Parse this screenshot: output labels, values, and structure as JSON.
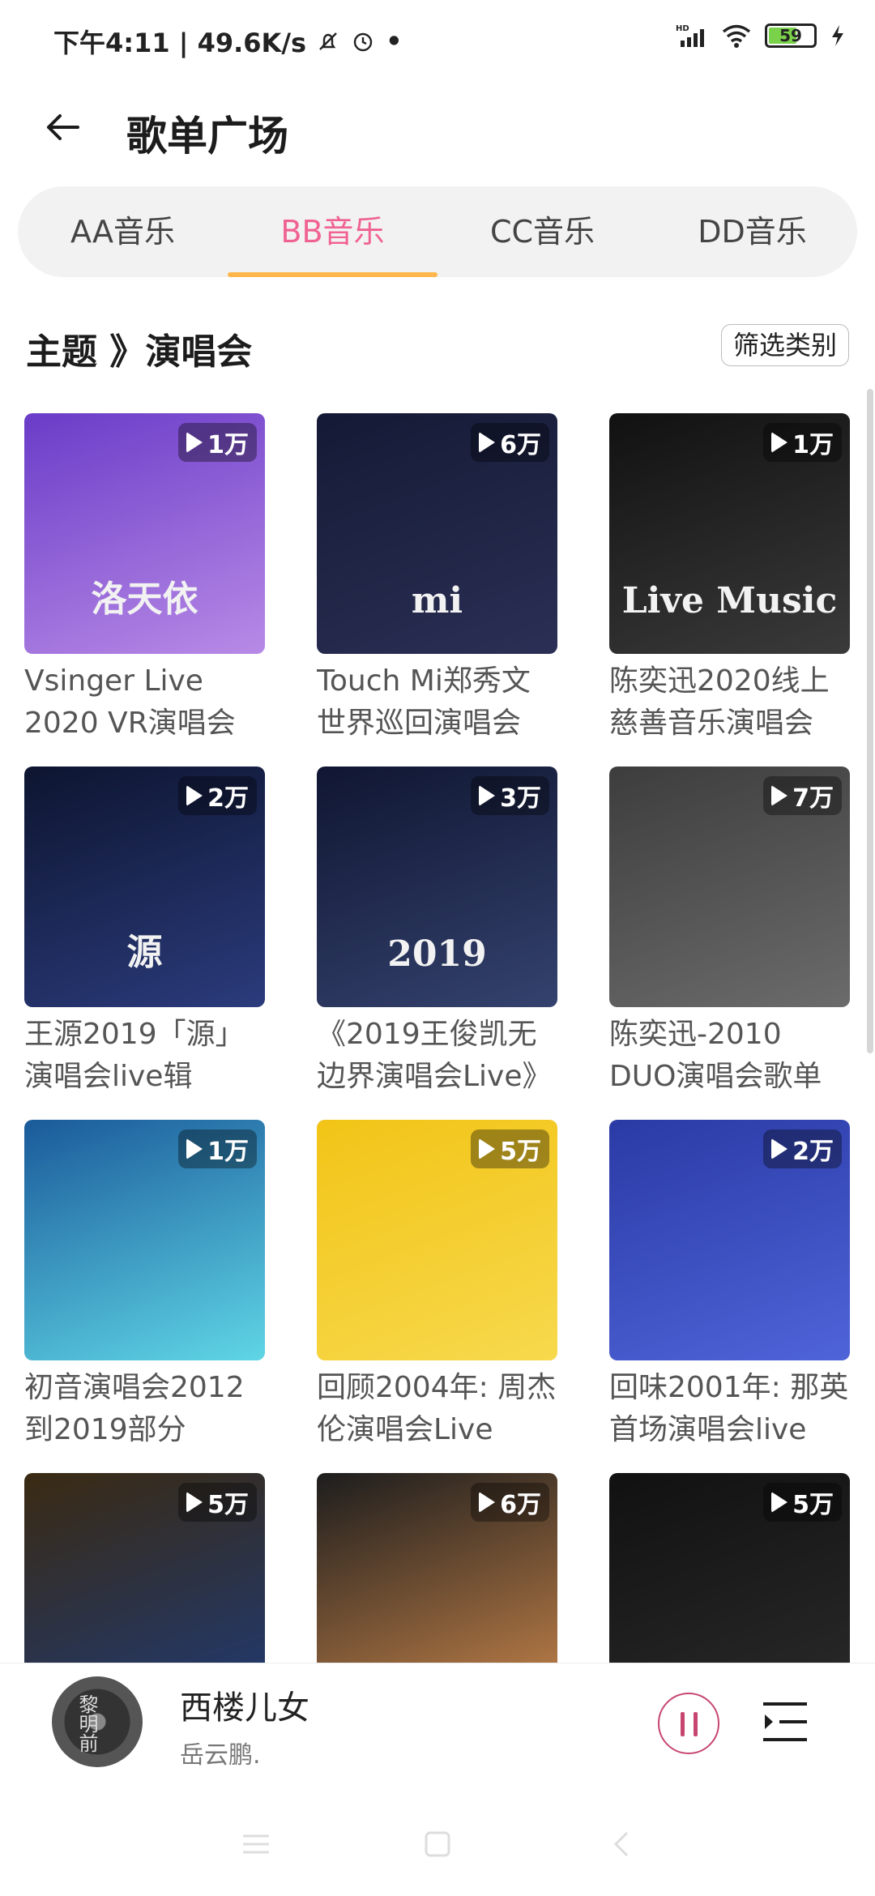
{
  "status_bar": {
    "time_speed": "下午4:11 | 49.6K/s",
    "battery": "59",
    "network": "HD"
  },
  "header": {
    "title": "歌单广场"
  },
  "tabs": [
    {
      "label": "AA音乐",
      "active": false
    },
    {
      "label": "BB音乐",
      "active": true
    },
    {
      "label": "CC音乐",
      "active": false
    },
    {
      "label": "DD音乐",
      "active": false
    }
  ],
  "section": {
    "crumb": "主题 》演唱会",
    "filter_label": "筛选类别"
  },
  "playlists": [
    {
      "name": "Vsinger Live 2020 VR演唱会",
      "plays": "1万",
      "cover_text": "洛天依",
      "cover_colors": [
        "#6a3cc8",
        "#b88ae6"
      ]
    },
    {
      "name": "Touch Mi郑秀文世界巡回演唱会",
      "plays": "6万",
      "cover_text": "mi",
      "cover_colors": [
        "#141a35",
        "#2b2f55"
      ]
    },
    {
      "name": "陈奕迅2020线上慈善音乐演唱会",
      "plays": "1万",
      "cover_text": "Live Music",
      "cover_colors": [
        "#111111",
        "#3a3a3a"
      ]
    },
    {
      "name": "王源2019「源」演唱会live辑",
      "plays": "2万",
      "cover_text": "源",
      "cover_colors": [
        "#0d1530",
        "#2b3b7c"
      ]
    },
    {
      "name": "《2019王俊凯无边界演唱会Live》",
      "plays": "3万",
      "cover_text": "2019",
      "cover_colors": [
        "#101632",
        "#34426e"
      ]
    },
    {
      "name": "陈奕迅-2010 DUO演唱会歌单",
      "plays": "7万",
      "cover_text": "",
      "cover_colors": [
        "#3d3d3d",
        "#6b6b6b"
      ]
    },
    {
      "name": "初音演唱会2012到2019部分",
      "plays": "1万",
      "cover_text": "",
      "cover_colors": [
        "#1a5a9a",
        "#5fd6e6"
      ]
    },
    {
      "name": "回顾2004年: 周杰伦演唱会Live",
      "plays": "5万",
      "cover_text": "",
      "cover_colors": [
        "#f2c417",
        "#f7d94c"
      ]
    },
    {
      "name": "回味2001年: 那英首场演唱会live",
      "plays": "2万",
      "cover_text": "",
      "cover_colors": [
        "#2a3aa5",
        "#4f64d9"
      ]
    },
    {
      "name": "",
      "plays": "5万",
      "cover_text": "",
      "cover_colors": [
        "#3a2a12",
        "#1f3a74"
      ]
    },
    {
      "name": "",
      "plays": "6万",
      "cover_text": "",
      "cover_colors": [
        "#1d1d1d",
        "#c8854a"
      ]
    },
    {
      "name": "",
      "plays": "5万",
      "cover_text": "",
      "cover_colors": [
        "#111111",
        "#2a2a2a"
      ]
    }
  ],
  "player": {
    "song": "西楼儿女",
    "artist": "岳云鹏.",
    "disc_text": "黎明前"
  }
}
